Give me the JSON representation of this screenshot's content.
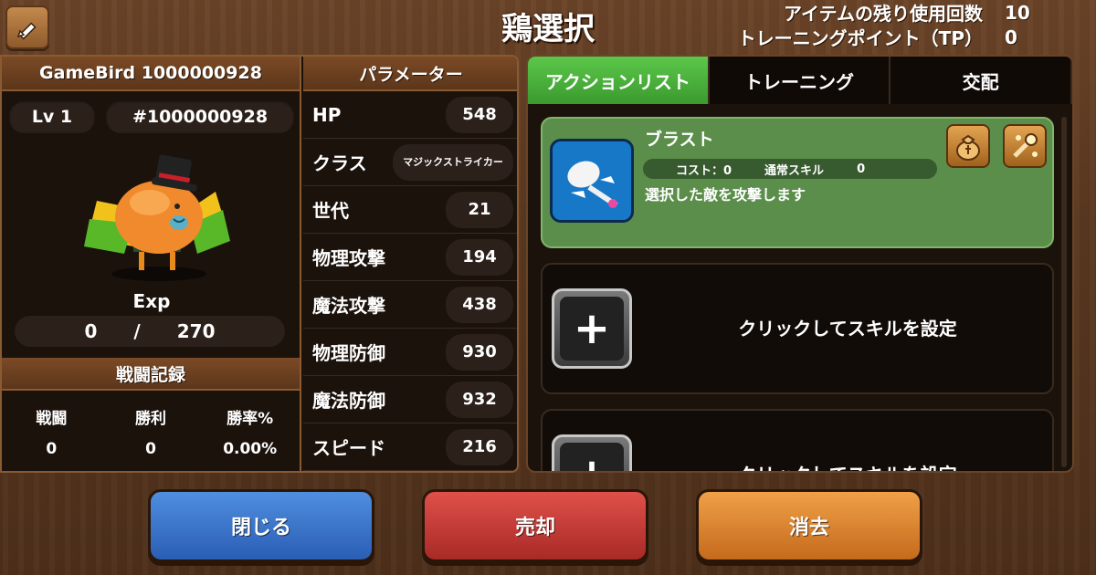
{
  "header": {
    "title": "鶏選択",
    "item_uses_label": "アイテムの残り使用回数",
    "item_uses_value": "10",
    "tp_label": "トレーニングポイント（TP）",
    "tp_value": "0"
  },
  "bird": {
    "name": "GameBird 1000000928",
    "level": "Lv 1",
    "id": "#1000000928",
    "exp_label": "Exp",
    "exp_current": "0",
    "exp_sep": "/",
    "exp_max": "270"
  },
  "battle": {
    "title": "戦闘記録",
    "headers": [
      "戦闘",
      "勝利",
      "勝率%"
    ],
    "values": [
      "0",
      "0",
      "0.00%"
    ]
  },
  "params": {
    "title": "パラメーター",
    "rows": [
      {
        "label": "HP",
        "value": "548"
      },
      {
        "label": "クラス",
        "value": "マジックストライカー"
      },
      {
        "label": "世代",
        "value": "21"
      },
      {
        "label": "物理攻撃",
        "value": "194"
      },
      {
        "label": "魔法攻撃",
        "value": "438"
      },
      {
        "label": "物理防御",
        "value": "930"
      },
      {
        "label": "魔法防御",
        "value": "932"
      },
      {
        "label": "スピード",
        "value": "216"
      }
    ]
  },
  "tabs": [
    "アクションリスト",
    "トレーニング",
    "交配"
  ],
  "skills": {
    "active": {
      "name": "ブラスト",
      "cost_label": "コスト：0",
      "type_label": "通常スキル",
      "type_value": "0",
      "description": "選択した敵を攻撃します"
    },
    "empty_label": "クリックしてスキルを設定"
  },
  "buttons": {
    "close": "閉じる",
    "sell": "売却",
    "erase": "消去"
  },
  "colors": {
    "tab_active": "#4cb83c",
    "btn_close": "#3a74cc",
    "btn_sell": "#c83a34",
    "btn_erase": "#e08632"
  }
}
